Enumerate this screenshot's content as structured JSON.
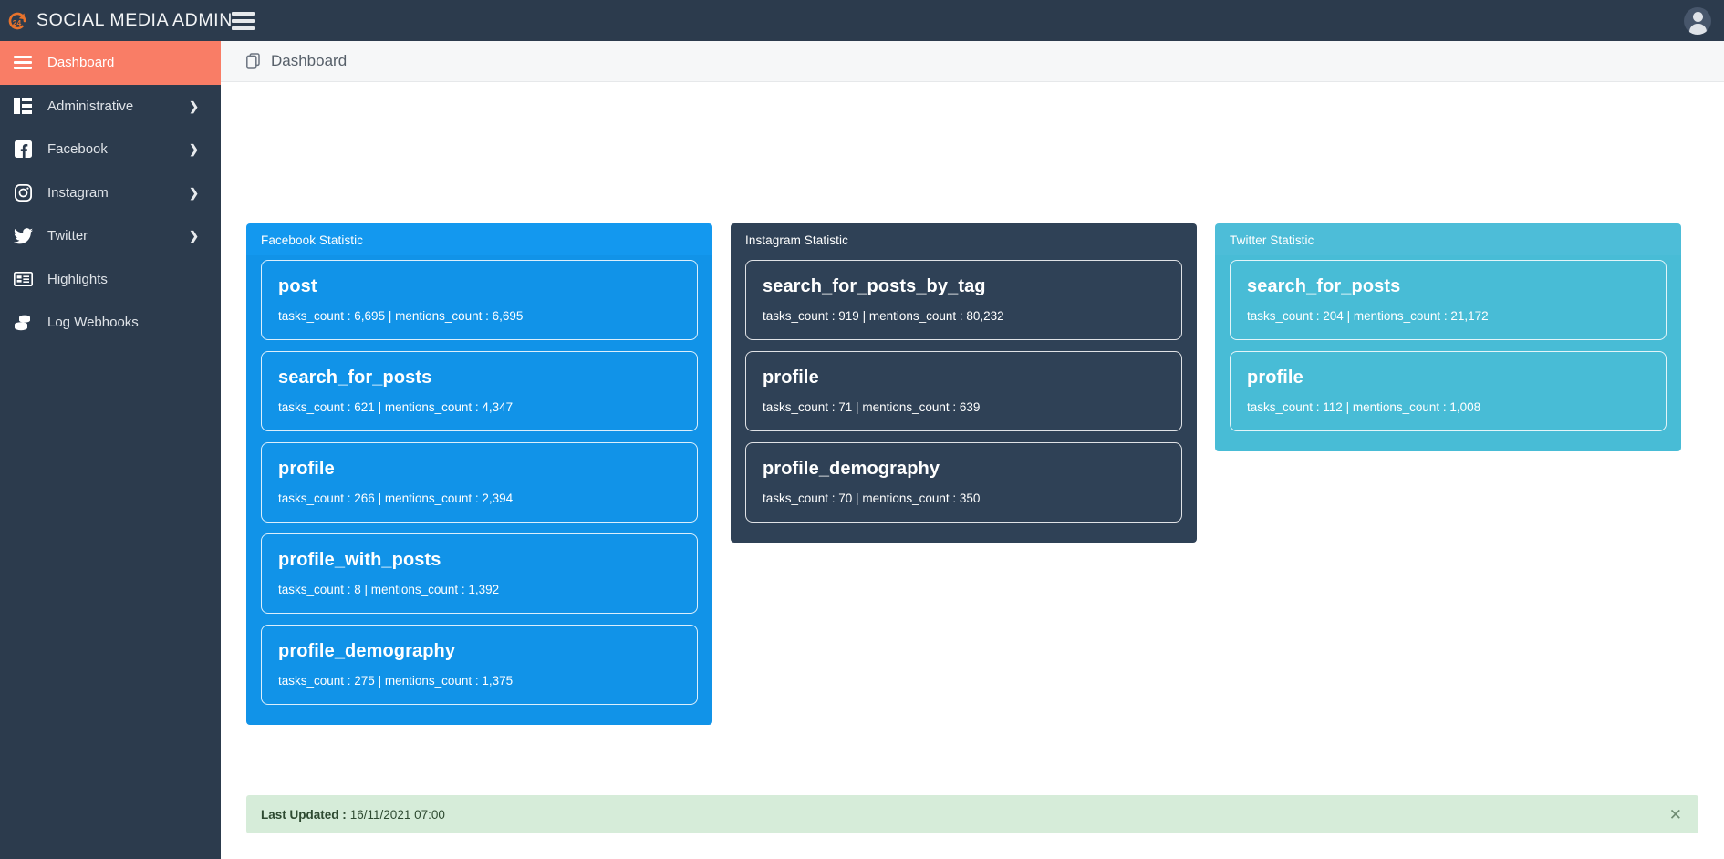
{
  "topbar": {
    "brand_title": "SOCIAL MEDIA ADMIN",
    "logo_icon": "rotate-24-icon",
    "menu_toggle_icon": "hamburger-icon",
    "avatar_icon": "user-avatar-icon"
  },
  "sidebar": {
    "items": [
      {
        "label": "Dashboard",
        "icon": "hamburger-icon",
        "active": true,
        "chevron": ""
      },
      {
        "label": "Administrative",
        "icon": "table-icon",
        "active": false,
        "chevron": "❯"
      },
      {
        "label": "Facebook",
        "icon": "facebook-icon",
        "active": false,
        "chevron": "❯"
      },
      {
        "label": "Instagram",
        "icon": "instagram-icon",
        "active": false,
        "chevron": "❯"
      },
      {
        "label": "Twitter",
        "icon": "twitter-icon",
        "active": false,
        "chevron": "❯"
      },
      {
        "label": "Highlights",
        "icon": "list-card-icon",
        "active": false,
        "chevron": ""
      },
      {
        "label": "Log Webhooks",
        "icon": "database-icon",
        "active": false,
        "chevron": ""
      }
    ]
  },
  "page": {
    "title": "Dashboard",
    "title_icon": "clone-icon"
  },
  "cards": [
    {
      "title": "Facebook Statistic",
      "accent": "#1193e8",
      "metrics": [
        {
          "name": "post",
          "stats": "tasks_count : 6,695 | mentions_count : 6,695"
        },
        {
          "name": "search_for_posts",
          "stats": "tasks_count : 621 | mentions_count : 4,347"
        },
        {
          "name": "profile",
          "stats": "tasks_count : 266 | mentions_count : 2,394"
        },
        {
          "name": "profile_with_posts",
          "stats": "tasks_count : 8 | mentions_count : 1,392"
        },
        {
          "name": "profile_demography",
          "stats": "tasks_count : 275 | mentions_count : 1,375"
        }
      ]
    },
    {
      "title": "Instagram Statistic",
      "accent": "#2f4156",
      "metrics": [
        {
          "name": "search_for_posts_by_tag",
          "stats": "tasks_count : 919 | mentions_count : 80,232"
        },
        {
          "name": "profile",
          "stats": "tasks_count : 71 | mentions_count : 639"
        },
        {
          "name": "profile_demography",
          "stats": "tasks_count : 70 | mentions_count : 350"
        }
      ]
    },
    {
      "title": "Twitter Statistic",
      "accent": "#4dbdd8",
      "metrics": [
        {
          "name": "search_for_posts",
          "stats": "tasks_count : 204 | mentions_count : 21,172"
        },
        {
          "name": "profile",
          "stats": "tasks_count : 112 | mentions_count : 1,008"
        }
      ]
    }
  ],
  "alert": {
    "label": "Last Updated :",
    "value": "16/11/2021 07:00",
    "close_icon": "close-icon"
  }
}
